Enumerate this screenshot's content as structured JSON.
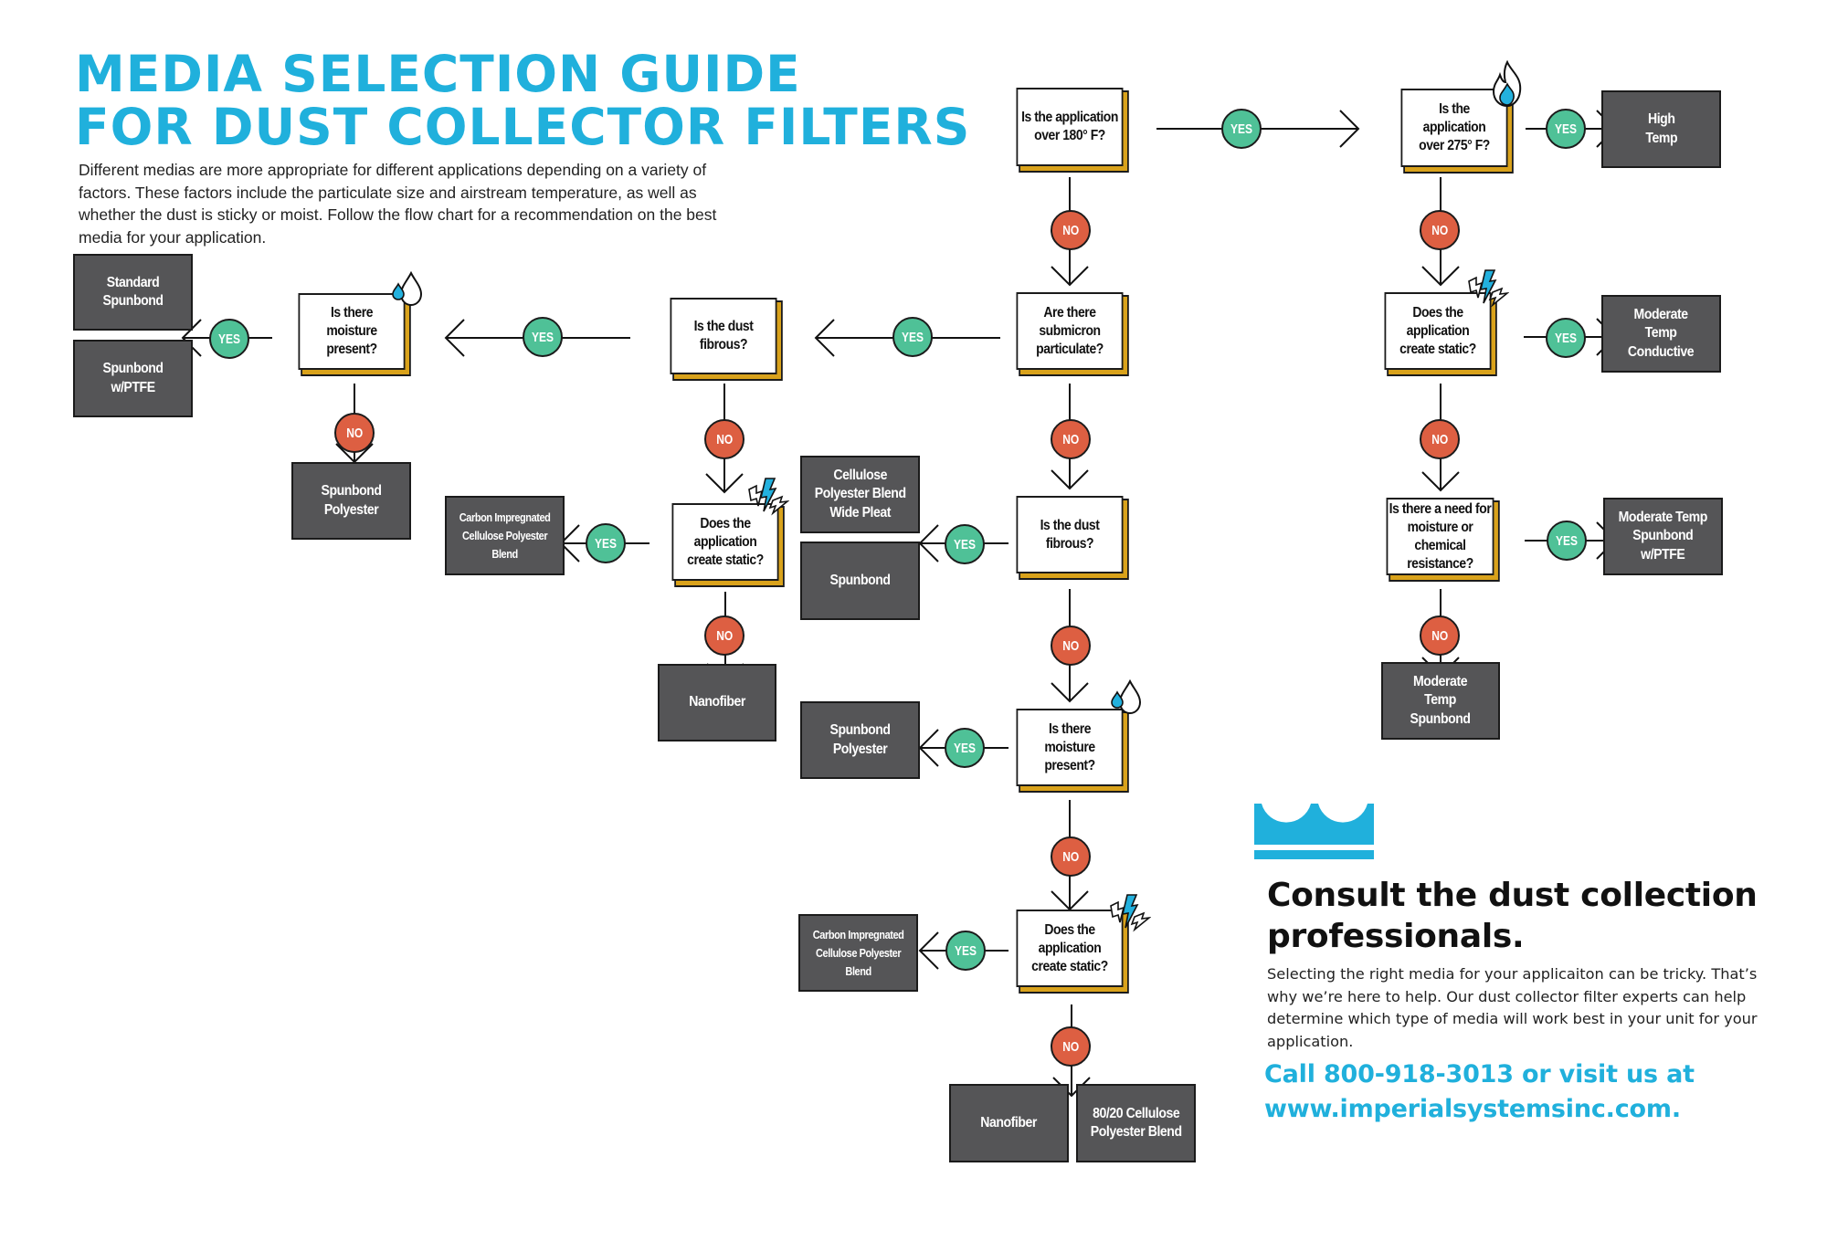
{
  "header": {
    "title_line1": "MEDIA SELECTION GUIDE",
    "title_line2": "FOR DUST COLLECTOR FILTERS",
    "intro": "Different medias are more appropriate for different applications depending on a variety of factors. These factors include the particulate size and airstream temperature, as well as whether the dust is sticky or moist. Follow the flow chart for a recommendation on the best media for your application."
  },
  "colors": {
    "brand_blue": "#20b0dc",
    "yes_green": "#4fc197",
    "no_red": "#dd5f42",
    "result_gray": "#555557",
    "question_shadow_gold": "#d9a21b"
  },
  "labels": {
    "yes": "YES",
    "no": "NO"
  },
  "questions": {
    "over180": "Is the application\nover 180° F?",
    "over275": "Is the\napplication\nover 275° F?",
    "submicron": "Are there\nsubmicron\nparticulate?",
    "fibrous_top": "Is the dust\nfibrous?",
    "moisture_top": "Is there\nmoisture\npresent?",
    "static_left": "Does the\napplication\ncreate static?",
    "fibrous_mid": "Is the dust\nfibrous?",
    "moisture_mid": "Is there\nmoisture\npresent?",
    "static_mid": "Does the\napplication\ncreate static?",
    "static_right": "Does the\napplication\ncreate static?",
    "chem_resist": "Is there a need for\nmoisture or\nchemical resistance?"
  },
  "results": {
    "high_temp": "High\nTemp",
    "mod_temp_conductive": "Moderate\nTemp\nConductive",
    "mod_temp_spunbond_ptfe": "Moderate Temp\nSpunbond\nw/PTFE",
    "mod_temp_spunbond": "Moderate\nTemp\nSpunbond",
    "standard_spunbond": "Standard\nSpunbond",
    "spunbond_ptfe": "Spunbond\nw/PTFE",
    "spunbond_polyester_top": "Spunbond\nPolyester",
    "carbon_left": "Carbon Impregnated\nCellulose Polyester\nBlend",
    "nanofiber_left": "Nanofiber",
    "cellulose_wide_pleat": "Cellulose\nPolyester Blend\nWide Pleat",
    "spunbond": "Spunbond",
    "spunbond_polyester_mid": "Spunbond\nPolyester",
    "carbon_mid": "Carbon Impregnated\nCellulose Polyester\nBlend",
    "nanofiber_bottom": "Nanofiber",
    "cellulose_8020": "80/20 Cellulose\nPolyester Blend"
  },
  "icons": {
    "flame": "flame-icon",
    "drop": "water-drop-icon",
    "static": "lightning-bolt-icon",
    "logo": "crown-logo"
  },
  "consult": {
    "heading": "Consult the dust collection\nprofessionals.",
    "body": "Selecting the right media for your applicaiton can be tricky. That’s why we’re here to help. Our dust collector filter experts can help determine which type of media will work best in your unit for your application.",
    "cta": "Call 800-918-3013 or visit us at\nwww.imperialsystemsinc.com."
  }
}
